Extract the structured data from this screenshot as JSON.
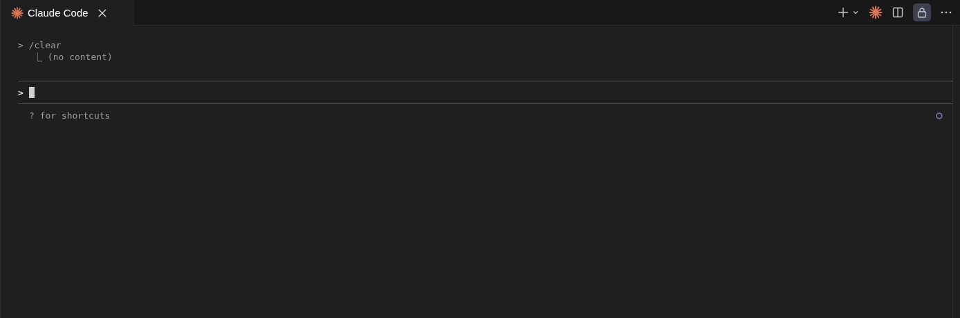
{
  "tabs": [
    {
      "label": "Claude Code",
      "selected": true
    }
  ],
  "toolbar": {
    "lock_on": true
  },
  "transcript": [
    {
      "prompt": ">",
      "command": "/clear",
      "result_mark": "⎿",
      "result": "(no content)"
    }
  ],
  "input": {
    "prompt": ">"
  },
  "hint": "? for shortcuts"
}
